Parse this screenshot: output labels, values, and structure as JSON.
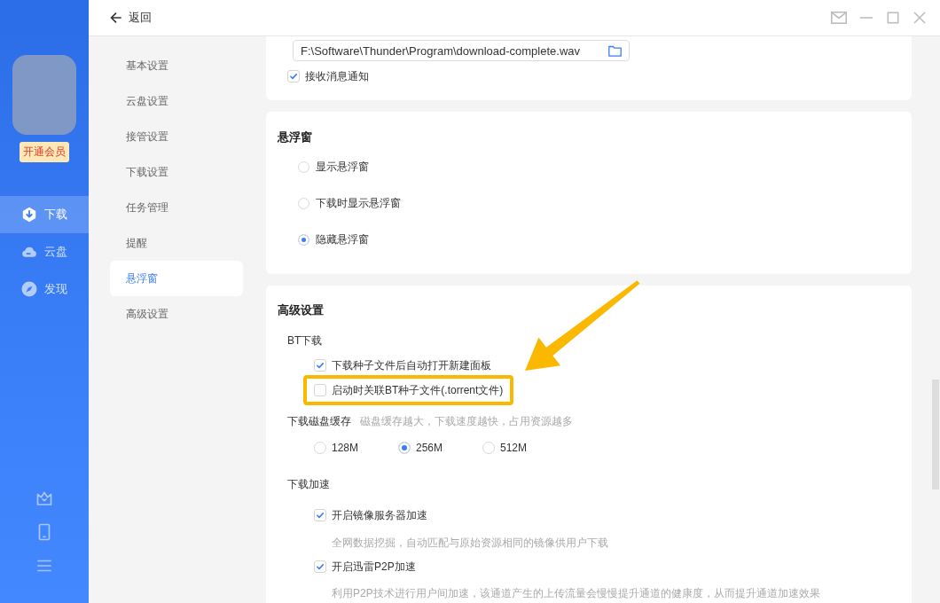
{
  "header": {
    "back_label": "返回"
  },
  "sidebar": {
    "vip_label": "开通会员",
    "items": [
      {
        "label": "下载",
        "selected": true
      },
      {
        "label": "云盘",
        "selected": false
      },
      {
        "label": "发现",
        "selected": false
      }
    ]
  },
  "settings_nav": {
    "items": [
      {
        "label": "基本设置",
        "selected": false
      },
      {
        "label": "云盘设置",
        "selected": false
      },
      {
        "label": "接管设置",
        "selected": false
      },
      {
        "label": "下载设置",
        "selected": false
      },
      {
        "label": "任务管理",
        "selected": false
      },
      {
        "label": "提醒",
        "selected": false
      },
      {
        "label": "悬浮窗",
        "selected": true
      },
      {
        "label": "高级设置",
        "selected": false
      }
    ]
  },
  "sections": [
    {
      "items": [
        {
          "kind": "path_field",
          "value": "F:\\Software\\Thunder\\Program\\download-complete.wav"
        },
        {
          "kind": "checkbox",
          "label": "接收消息通知",
          "checked": true,
          "highlighted": false
        }
      ]
    },
    {
      "title": "悬浮窗",
      "items": [
        {
          "kind": "radio",
          "label": "显示悬浮窗",
          "selected": false
        },
        {
          "kind": "radio",
          "label": "下载时显示悬浮窗",
          "selected": false
        },
        {
          "kind": "radio",
          "label": "隐藏悬浮窗",
          "selected": true
        }
      ]
    },
    {
      "title": "高级设置",
      "groups": [
        {
          "label": "BT下载",
          "items": [
            {
              "kind": "checkbox",
              "label": "下载种子文件后自动打开新建面板",
              "checked": true,
              "highlighted": false
            },
            {
              "kind": "checkbox",
              "label": "启动时关联BT种子文件(.torrent文件)",
              "checked": false,
              "highlighted": true
            }
          ]
        },
        {
          "label": "下载磁盘缓存",
          "hint": "磁盘缓存越大，下载速度越快，占用资源越多",
          "options": [
            {
              "label": "128M",
              "selected": false
            },
            {
              "label": "256M",
              "selected": true
            },
            {
              "label": "512M",
              "selected": false
            }
          ]
        },
        {
          "label": "下载加速",
          "items": [
            {
              "kind": "checkbox",
              "label": "开启镜像服务器加速",
              "checked": true,
              "highlighted": false
            },
            {
              "kind": "description",
              "text": "全网数据挖掘，自动匹配与原始资源相同的镜像供用户下载"
            },
            {
              "kind": "checkbox",
              "label": "开启迅雷P2P加速",
              "checked": true,
              "highlighted": false
            },
            {
              "kind": "description",
              "text": "利用P2P技术进行用户间加速，该通道产生的上传流量会慢慢提升通道的健康度，从而提升通道加速效果"
            }
          ]
        }
      ]
    }
  ]
}
